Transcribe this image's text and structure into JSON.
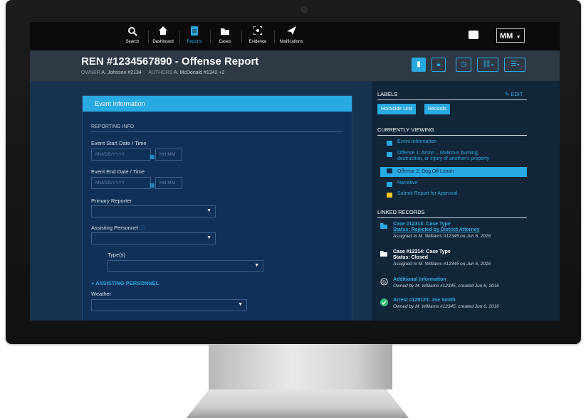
{
  "nav": {
    "items": [
      {
        "label": "Search",
        "icon": "search-icon"
      },
      {
        "label": "Dashboard",
        "icon": "home-icon"
      },
      {
        "label": "Reports",
        "icon": "report-icon"
      },
      {
        "label": "Cases",
        "icon": "folder-icon"
      },
      {
        "label": "Evidence",
        "icon": "evidence-icon"
      },
      {
        "label": "Notifications",
        "icon": "paper-plane-icon"
      }
    ],
    "active": "Reports",
    "user_initials": "MM"
  },
  "header": {
    "title": "REN #1234567890 - Offense Report",
    "owner_label": "OWNER",
    "owner": "A. Johnson #2134",
    "authors_label": "AUTHORS",
    "authors": "A. McDonald #1342 +2"
  },
  "form": {
    "card_title": "Event Information",
    "section_title": "REPORTING INFO",
    "start_label": "Event Start Date / Time",
    "end_label": "Event End Date / Time",
    "date_placeholder": "MM/DD/YYYY",
    "time_placeholder": "HH:MM",
    "primary_reporter_label": "Primary Reporter",
    "assisting_personnel_label": "Assisting Personnel",
    "types_label": "Type(s)",
    "add_assisting_label": "+ ASSISTING PERSONNEL",
    "weather_label": "Weather"
  },
  "labels_panel": {
    "title": "LABELS",
    "edit": "EDIT",
    "tags": [
      "Homicide Unit",
      "Records"
    ]
  },
  "viewing": {
    "title": "CURRENTLY VIEWING",
    "items": [
      "Event Information",
      "Offense 1: Arson – Malicous burning,",
      "destruction, or injury of another's property",
      "Offense 2: Dog Off Leash",
      "Narrative",
      "Submit Report for Approval"
    ]
  },
  "linked": {
    "title": "LINKED RECORDS",
    "records": [
      {
        "line1": "Case #12313: Case Type",
        "line2": "Status: Rejected by District Attorney",
        "line3": "Assigned to M. Williams #12345 on Jun 6, 2016"
      },
      {
        "line1": "Case #12314: Case Type",
        "line2": "Status: Closed",
        "line3": "Assigned to M. Williams #12345 on Jun 6, 2016"
      },
      {
        "line1": "Additional Information",
        "line2": "Owned by M. Williams #12345, created Jun 6, 2016"
      },
      {
        "line1": "Arrest #129123: Joe Smith",
        "line2": "Owned by M. Williams #12345, created Jun 6, 2016"
      }
    ]
  },
  "colors": {
    "accent": "#29a9e1",
    "background": "#12263a",
    "card": "#0f3057",
    "nav": "#0b0b0c"
  }
}
